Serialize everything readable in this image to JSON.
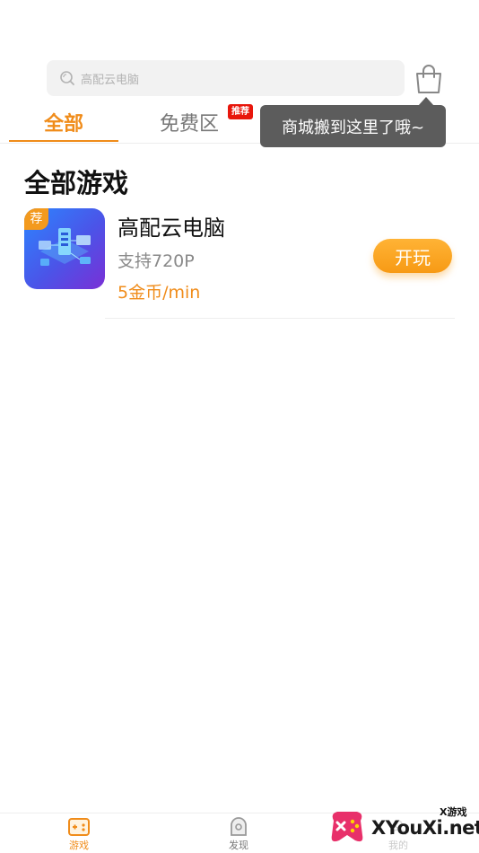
{
  "search": {
    "placeholder": "高配云电脑"
  },
  "tabs": [
    {
      "label": "全部"
    },
    {
      "label": "免费区",
      "badge": "推荐"
    }
  ],
  "tooltip": {
    "text": "商城搬到这里了哦~"
  },
  "section": {
    "title": "全部游戏"
  },
  "games": [
    {
      "badge": "荐",
      "name": "高配云电脑",
      "spec": "支持720P",
      "price": "5金币/min",
      "action": "开玩"
    }
  ],
  "bottom_nav": [
    {
      "label": "游戏",
      "icon": "gamepad-icon",
      "active": true
    },
    {
      "label": "发现",
      "icon": "discover-icon",
      "active": false
    },
    {
      "label": "我的",
      "icon": "profile-icon",
      "active": false
    }
  ],
  "watermark": {
    "small": "X游戏",
    "big": "XYouXi.net"
  },
  "colors": {
    "accent": "#f08c1a",
    "badge_red": "#e8160c",
    "tooltip_bg": "#5c5c5c"
  }
}
